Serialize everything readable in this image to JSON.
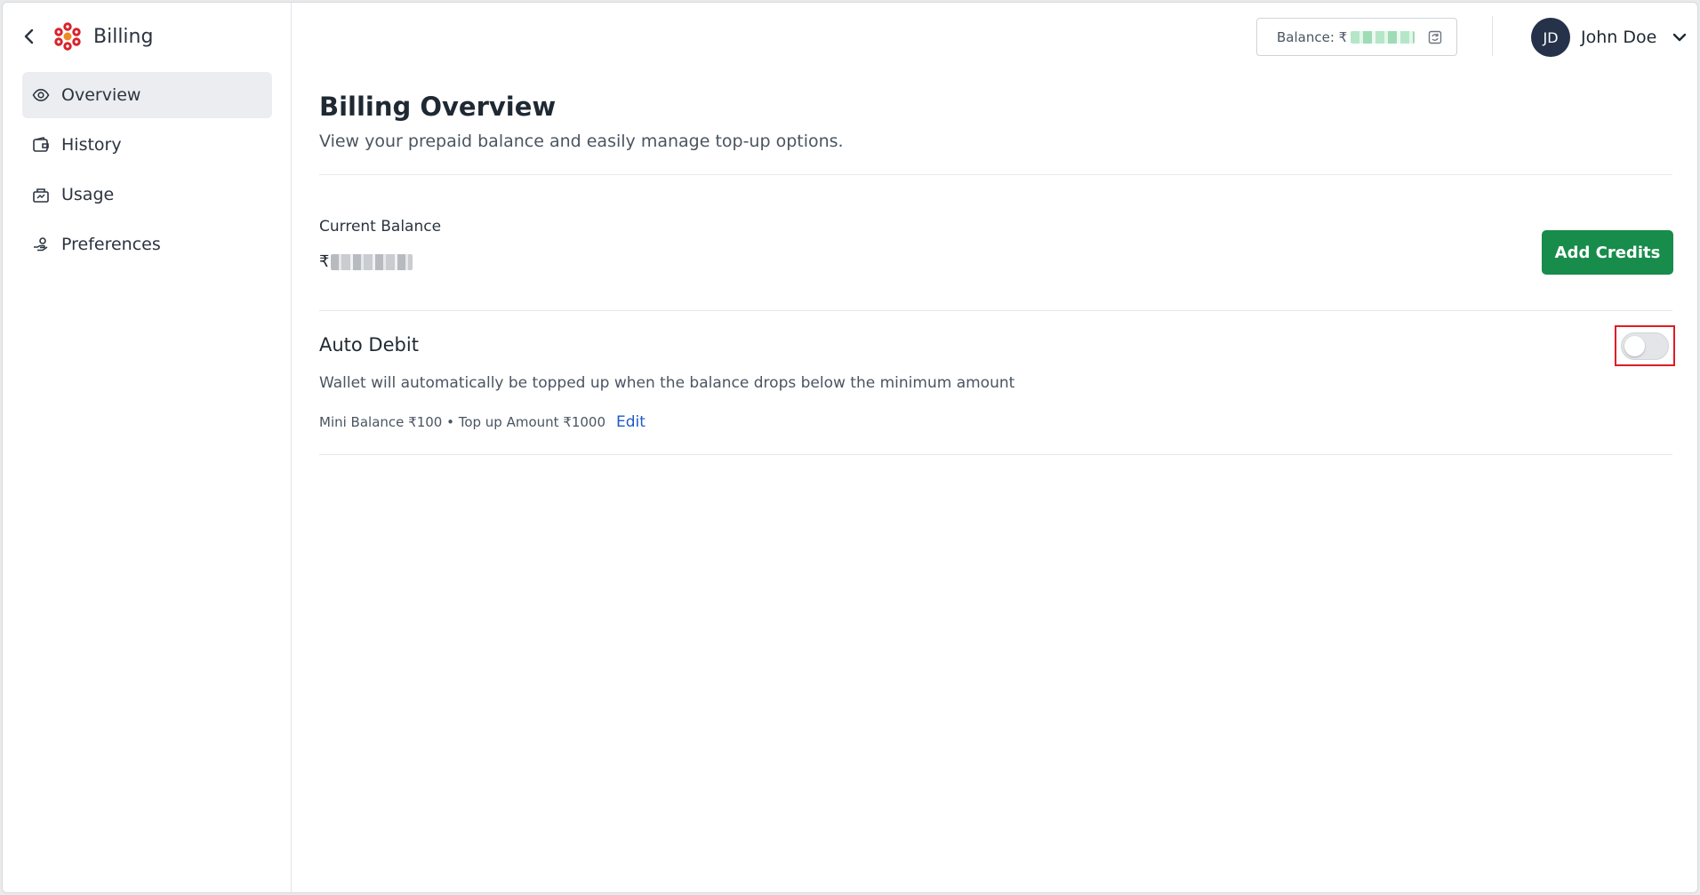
{
  "sidebar": {
    "title": "Billing",
    "items": [
      {
        "label": "Overview",
        "icon": "eye-icon",
        "active": true
      },
      {
        "label": "History",
        "icon": "wallet-icon",
        "active": false
      },
      {
        "label": "Usage",
        "icon": "usage-icon",
        "active": false
      },
      {
        "label": "Preferences",
        "icon": "preferences-icon",
        "active": false
      }
    ]
  },
  "topbar": {
    "balance_label": "Balance: ₹",
    "user": {
      "initials": "JD",
      "name": "John Doe"
    }
  },
  "main": {
    "title": "Billing Overview",
    "subtitle": "View your prepaid balance and easily manage top-up options.",
    "current_balance_label": "Current Balance",
    "current_balance_currency": "₹",
    "add_credits_label": "Add Credits",
    "auto_debit": {
      "title": "Auto Debit",
      "description": "Wallet will automatically be topped up when the balance drops below the minimum amount",
      "meta": "Mini Balance ₹100 • Top up Amount ₹1000",
      "edit_label": "Edit",
      "enabled": false
    }
  },
  "colors": {
    "accent_green": "#178c4b",
    "link_blue": "#2159c7",
    "avatar_bg": "#25324a",
    "highlight_red": "#e01b24"
  }
}
